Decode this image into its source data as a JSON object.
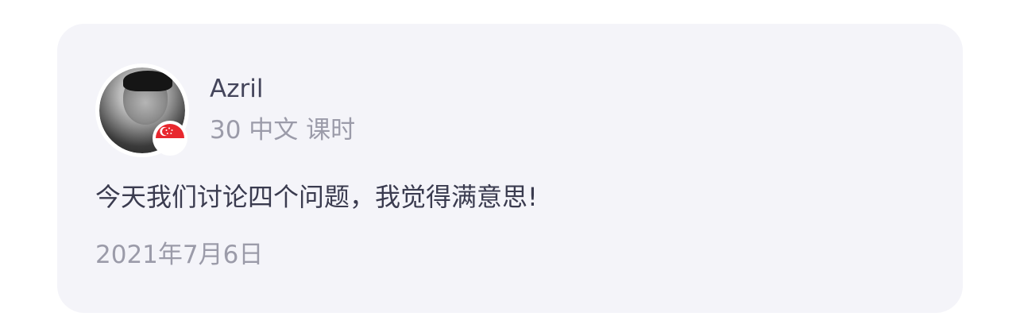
{
  "review": {
    "user": {
      "name": "Azril",
      "lessons_label": "30 中文 课时",
      "avatar_icon": "user-photo-avatar",
      "flag_icon": "singapore-flag-icon"
    },
    "text": "今天我们讨论四个问题，我觉得满意思!",
    "date": "2021年7月6日"
  },
  "colors": {
    "card_background": "#f4f4f9",
    "primary_text": "#44455b",
    "secondary_text": "#9b9ba9",
    "flag_red": "#e8272e"
  }
}
